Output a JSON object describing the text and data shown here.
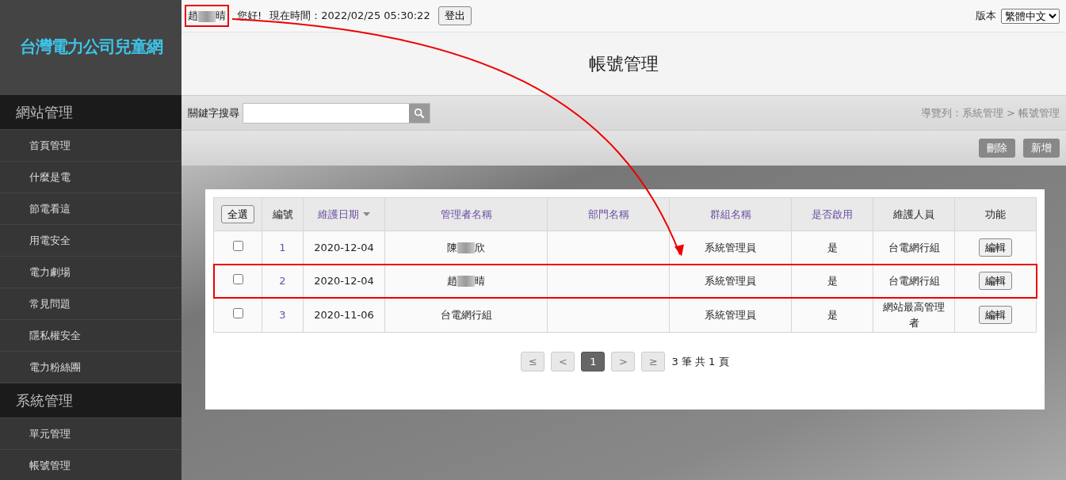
{
  "logo": {
    "text": "台灣電力公司兒童網"
  },
  "sidebar": {
    "sections": [
      {
        "title": "網站管理",
        "items": [
          {
            "label": "首頁管理"
          },
          {
            "label": "什麼是電"
          },
          {
            "label": "節電看這"
          },
          {
            "label": "用電安全"
          },
          {
            "label": "電力劇場"
          },
          {
            "label": "常見問題"
          },
          {
            "label": "隱私權安全"
          },
          {
            "label": "電力粉絲團"
          }
        ]
      },
      {
        "title": "系統管理",
        "items": [
          {
            "label": "單元管理"
          },
          {
            "label": "帳號管理"
          }
        ]
      }
    ]
  },
  "top_bar": {
    "user_name": {
      "first": "趙",
      "last": "晴",
      "highlighted": true
    },
    "greeting": "您好!",
    "time_label": "現在時間：2022/02/25 05:30:22",
    "logout_button": "登出",
    "version_label": "版本",
    "version_value": "繁體中文"
  },
  "page_title": "帳號管理",
  "search": {
    "label": "關鍵字搜尋"
  },
  "breadcrumb": "導覽列：系統管理 > 帳號管理",
  "actions": [
    "刪除",
    "新增"
  ],
  "table": {
    "select_all": "全選",
    "columns": [
      {
        "label": "編號",
        "sortable": false,
        "sorted": false
      },
      {
        "label": "維護日期",
        "sortable": true,
        "sorted": true
      },
      {
        "label": "管理者名稱",
        "sortable": true,
        "sorted": false
      },
      {
        "label": "部門名稱",
        "sortable": true,
        "sorted": false
      },
      {
        "label": "群組名稱",
        "sortable": true,
        "sorted": false
      },
      {
        "label": "是否啟用",
        "sortable": true,
        "sorted": false
      },
      {
        "label": "維護人員",
        "sortable": false,
        "sorted": false
      },
      {
        "label": "功能",
        "sortable": false,
        "sorted": false
      }
    ],
    "rows": [
      {
        "checked": false,
        "highlighted": false,
        "no": "1",
        "date": "2020-12-04",
        "name": {
          "first": "陳",
          "last": "欣"
        },
        "group": "系統管理員",
        "enabled": "是",
        "maintainer": "台電網行組",
        "action": "編輯"
      },
      {
        "checked": false,
        "highlighted": true,
        "no": "2",
        "date": "2020-12-04",
        "name": {
          "first": "趙",
          "last": "晴"
        },
        "group": "系統管理員",
        "enabled": "是",
        "maintainer": "台電網行組",
        "action": "編輯"
      },
      {
        "checked": false,
        "highlighted": false,
        "no": "3",
        "date": "2020-11-06",
        "name": {
          "first": "台電網行組"
        },
        "group": "系統管理員",
        "enabled": "是",
        "maintainer": "網站最高管理者",
        "action": "編輯"
      }
    ]
  },
  "pagination": {
    "buttons": [
      {
        "label": "≤",
        "selected": false
      },
      {
        "label": "<",
        "selected": false
      },
      {
        "label": "1",
        "selected": true
      },
      {
        "label": ">",
        "selected": false
      },
      {
        "label": "≥",
        "selected": false
      }
    ],
    "summary": "3 筆 共 1 頁"
  }
}
